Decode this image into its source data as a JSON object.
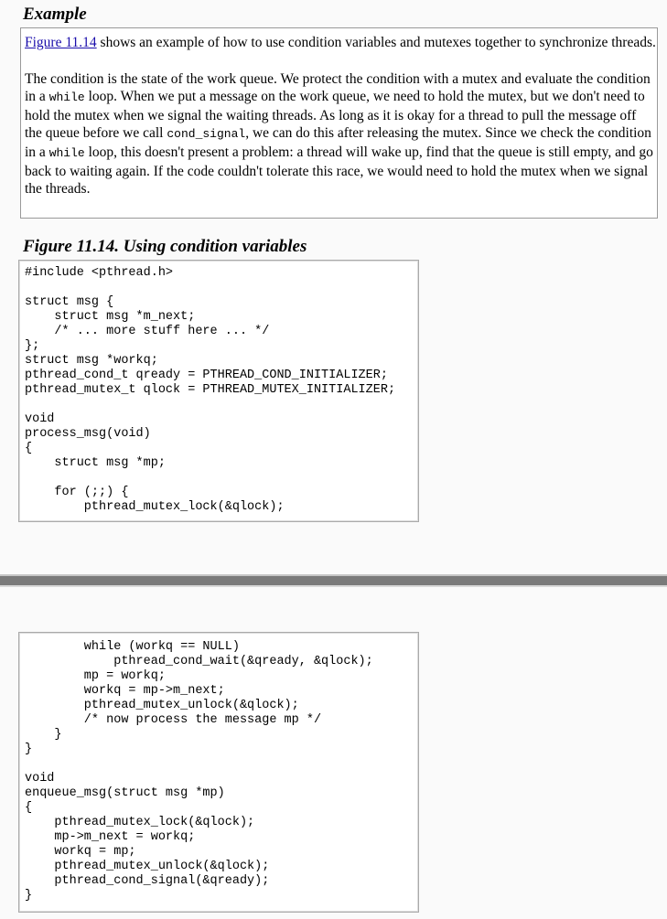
{
  "example": {
    "heading": "Example",
    "para1": {
      "link": "Figure 11.14",
      "text": " shows an example of how to use condition variables and mutexes together to synchronize threads."
    },
    "para2": [
      {
        "t": "The condition is the state of the work queue. We protect the condition with a mutex and evaluate the condition in a "
      },
      {
        "c": "while"
      },
      {
        "t": " loop. When we put a message on the work queue, we need to hold the mutex, but we don't need to hold the mutex when we signal the waiting threads. As long as it is okay for a thread to pull the message off the queue before we call "
      },
      {
        "c": "cond_signal"
      },
      {
        "t": ", we can do this after releasing the mutex. Since we check the condition in a "
      },
      {
        "c": "while"
      },
      {
        "t": " loop, this doesn't present a problem: a thread will wake up, find that the queue is still empty, and go back to waiting again. If the code couldn't tolerate this race, we would need to hold the mutex when we signal the threads."
      }
    ]
  },
  "figure": {
    "caption": "Figure 11.14. Using condition variables",
    "code_part1": [
      "#include <pthread.h>",
      "",
      "struct msg {",
      "    struct msg *m_next;",
      "    /* ... more stuff here ... */",
      "};",
      "struct msg *workq;",
      "pthread_cond_t qready = PTHREAD_COND_INITIALIZER;",
      "pthread_mutex_t qlock = PTHREAD_MUTEX_INITIALIZER;",
      "",
      "void",
      "process_msg(void)",
      "{",
      "    struct msg *mp;",
      "",
      "    for (;;) {",
      "        pthread_mutex_lock(&qlock);"
    ],
    "code_part2": [
      "        while (workq == NULL)",
      "            pthread_cond_wait(&qready, &qlock);",
      "        mp = workq;",
      "        workq = mp->m_next;",
      "        pthread_mutex_unlock(&qlock);",
      "        /* now process the message mp */",
      "    }",
      "}",
      "",
      "void",
      "enqueue_msg(struct msg *mp)",
      "{",
      "    pthread_mutex_lock(&qlock);",
      "    mp->m_next = workq;",
      "    workq = mp;",
      "    pthread_mutex_unlock(&qlock);",
      "    pthread_cond_signal(&qready);",
      "}"
    ]
  }
}
